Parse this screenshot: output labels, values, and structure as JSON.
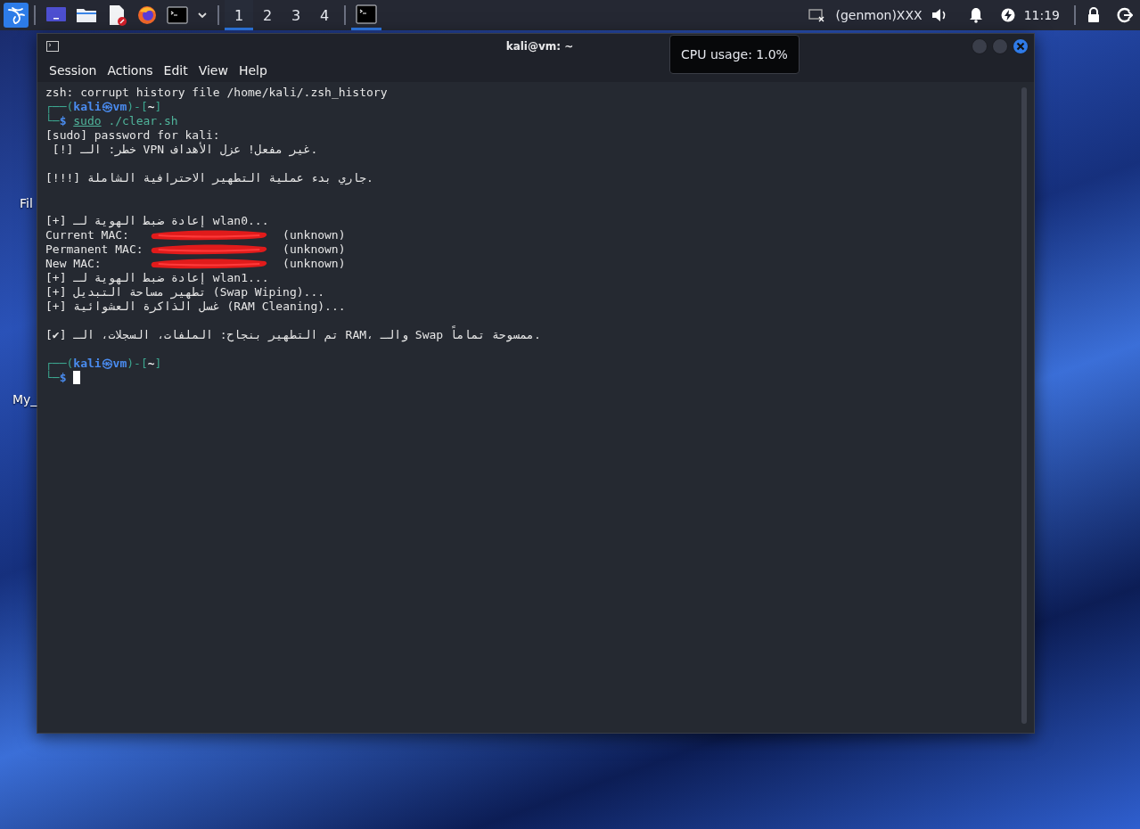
{
  "taskbar": {
    "workspaces": [
      {
        "label": "1",
        "selected": true
      },
      {
        "label": "2",
        "selected": false
      },
      {
        "label": "3",
        "selected": false
      },
      {
        "label": "4",
        "selected": false
      }
    ],
    "window_button": {
      "selected": true
    },
    "genmon": "(genmon)XXX",
    "clock": "11:19"
  },
  "desktop": {
    "icons": [
      {
        "label": "Fil"
      },
      {
        "label": "My_"
      }
    ]
  },
  "window": {
    "title": "kali@vm: ~",
    "menu": [
      "Session",
      "Actions",
      "Edit",
      "View",
      "Help"
    ],
    "lines": [
      {
        "kind": "text",
        "text": "zsh: corrupt history file /home/kali/.zsh_history"
      },
      {
        "kind": "prompt",
        "segments": [
          {
            "kind": "frame",
            "text": "┌──("
          },
          {
            "kind": "user",
            "text": "kali㉿vm"
          },
          {
            "kind": "frame",
            "text": ")-["
          },
          {
            "kind": "path",
            "text": "~"
          },
          {
            "kind": "frame",
            "text": "]"
          }
        ]
      },
      {
        "kind": "prompt",
        "segments": [
          {
            "kind": "frame",
            "text": "└─"
          },
          {
            "kind": "symbol",
            "text": "$"
          },
          {
            "kind": "command",
            "text": "sudo"
          },
          {
            "kind": "arg",
            "text": "./clear.sh"
          }
        ]
      },
      {
        "kind": "text",
        "text": "[sudo] password for kali:"
      },
      {
        "kind": "text",
        "text": " [!] خطر: الـ VPN غير مفعل! عزل الأهداف."
      },
      {
        "kind": "blank"
      },
      {
        "kind": "text",
        "text": "[!!!] جاري بدء عملية التطهير الاحترافية الشاملة."
      },
      {
        "kind": "blank"
      },
      {
        "kind": "blank"
      },
      {
        "kind": "text",
        "text": "[+] إعادة ضبط الهوية لـ wlan0..."
      },
      {
        "kind": "mac",
        "label": "Current MAC:",
        "value": "(unknown)"
      },
      {
        "kind": "mac",
        "label": "Permanent MAC:",
        "value": "(unknown)"
      },
      {
        "kind": "mac",
        "label": "New MAC:",
        "value": "(unknown)"
      },
      {
        "kind": "text",
        "text": "[+] إعادة ضبط الهوية لـ wlan1..."
      },
      {
        "kind": "text",
        "text": "[+] تطهير مساحة التبديل (Swap Wiping)..."
      },
      {
        "kind": "text",
        "text": "[+] غسل الذاكرة العشوائية (RAM Cleaning)..."
      },
      {
        "kind": "blank"
      },
      {
        "kind": "text",
        "text": "[✔] تم التطهير بنجاح: الملفات، السجلات، الـ RAM، والـ Swap ممسوحة تماماً."
      },
      {
        "kind": "blank"
      },
      {
        "kind": "prompt",
        "segments": [
          {
            "kind": "frame",
            "text": "┌──("
          },
          {
            "kind": "user",
            "text": "kali㉿vm"
          },
          {
            "kind": "frame",
            "text": ")-["
          },
          {
            "kind": "path",
            "text": "~"
          },
          {
            "kind": "frame",
            "text": "]"
          }
        ]
      },
      {
        "kind": "prompt",
        "cursor": true,
        "segments": [
          {
            "kind": "frame",
            "text": "└─"
          },
          {
            "kind": "symbol",
            "text": "$"
          }
        ]
      }
    ]
  },
  "tooltip": {
    "text": "CPU usage: 1.0%"
  }
}
